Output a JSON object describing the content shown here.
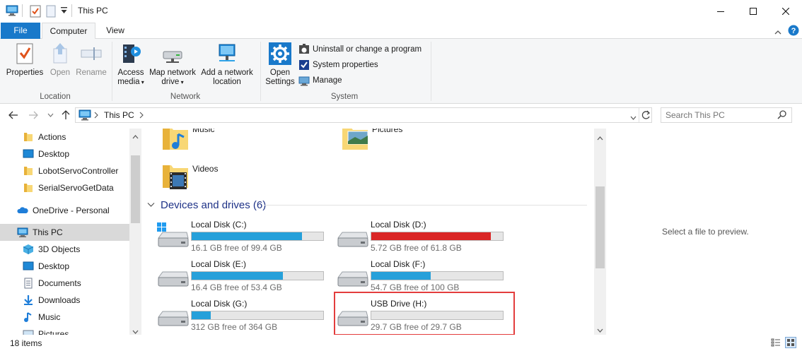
{
  "window": {
    "title": "This PC"
  },
  "ribbon_tabs": {
    "file": "File",
    "computer": "Computer",
    "view": "View"
  },
  "ribbon": {
    "location": {
      "label": "Location",
      "properties": "Properties",
      "open": "Open",
      "rename": "Rename"
    },
    "network": {
      "label": "Network",
      "access_media_1": "Access",
      "access_media_2": "media",
      "map_drive_1": "Map network",
      "map_drive_2": "drive",
      "add_location_1": "Add a network",
      "add_location_2": "location"
    },
    "system": {
      "label": "System",
      "open_settings_1": "Open",
      "open_settings_2": "Settings",
      "uninstall": "Uninstall or change a program",
      "system_properties": "System properties",
      "manage": "Manage"
    }
  },
  "address": {
    "path": "This PC",
    "search_placeholder": "Search This PC"
  },
  "nav_pane": {
    "items": [
      {
        "label": "Actions",
        "icon": "folder-yellow-icon"
      },
      {
        "label": "Desktop",
        "icon": "desktop-icon"
      },
      {
        "label": "LobotServoController",
        "icon": "folder-yellow-icon"
      },
      {
        "label": "SerialServoGetData",
        "icon": "folder-yellow-icon"
      },
      {
        "label": "OneDrive - Personal",
        "icon": "onedrive-cloud-icon"
      },
      {
        "label": "This PC",
        "icon": "this-pc-icon",
        "selected": true
      },
      {
        "label": "3D Objects",
        "icon": "3d-objects-icon"
      },
      {
        "label": "Desktop",
        "icon": "desktop-icon"
      },
      {
        "label": "Documents",
        "icon": "documents-icon"
      },
      {
        "label": "Downloads",
        "icon": "downloads-icon"
      },
      {
        "label": "Music",
        "icon": "music-icon"
      },
      {
        "label": "Pictures",
        "icon": "pictures-icon"
      }
    ]
  },
  "content": {
    "folders": {
      "music": "Music",
      "pictures": "Pictures",
      "videos": "Videos"
    },
    "devices_header": "Devices and drives (6)",
    "drives": [
      {
        "name": "Local Disk (C:)",
        "free": "16.1 GB free of 99.4 GB",
        "used_fraction": 0.838,
        "color": "#26a0da",
        "os": true
      },
      {
        "name": "Local Disk (D:)",
        "free": "5.72 GB free of 61.8 GB",
        "used_fraction": 0.907,
        "color": "#da2626"
      },
      {
        "name": "Local Disk (E:)",
        "free": "16.4 GB free of 53.4 GB",
        "used_fraction": 0.693,
        "color": "#26a0da"
      },
      {
        "name": "Local Disk (F:)",
        "free": "54.7 GB free of 100 GB",
        "used_fraction": 0.453,
        "color": "#26a0da"
      },
      {
        "name": "Local Disk (G:)",
        "free": "312 GB free of 364 GB",
        "used_fraction": 0.143,
        "color": "#26a0da"
      },
      {
        "name": "USB Drive (H:)",
        "free": "29.7 GB free of 29.7 GB",
        "used_fraction": 0.0,
        "color": "#26a0da",
        "highlighted": true
      }
    ]
  },
  "preview": {
    "text": "Select a file to preview."
  },
  "status": {
    "items": "18 items"
  }
}
